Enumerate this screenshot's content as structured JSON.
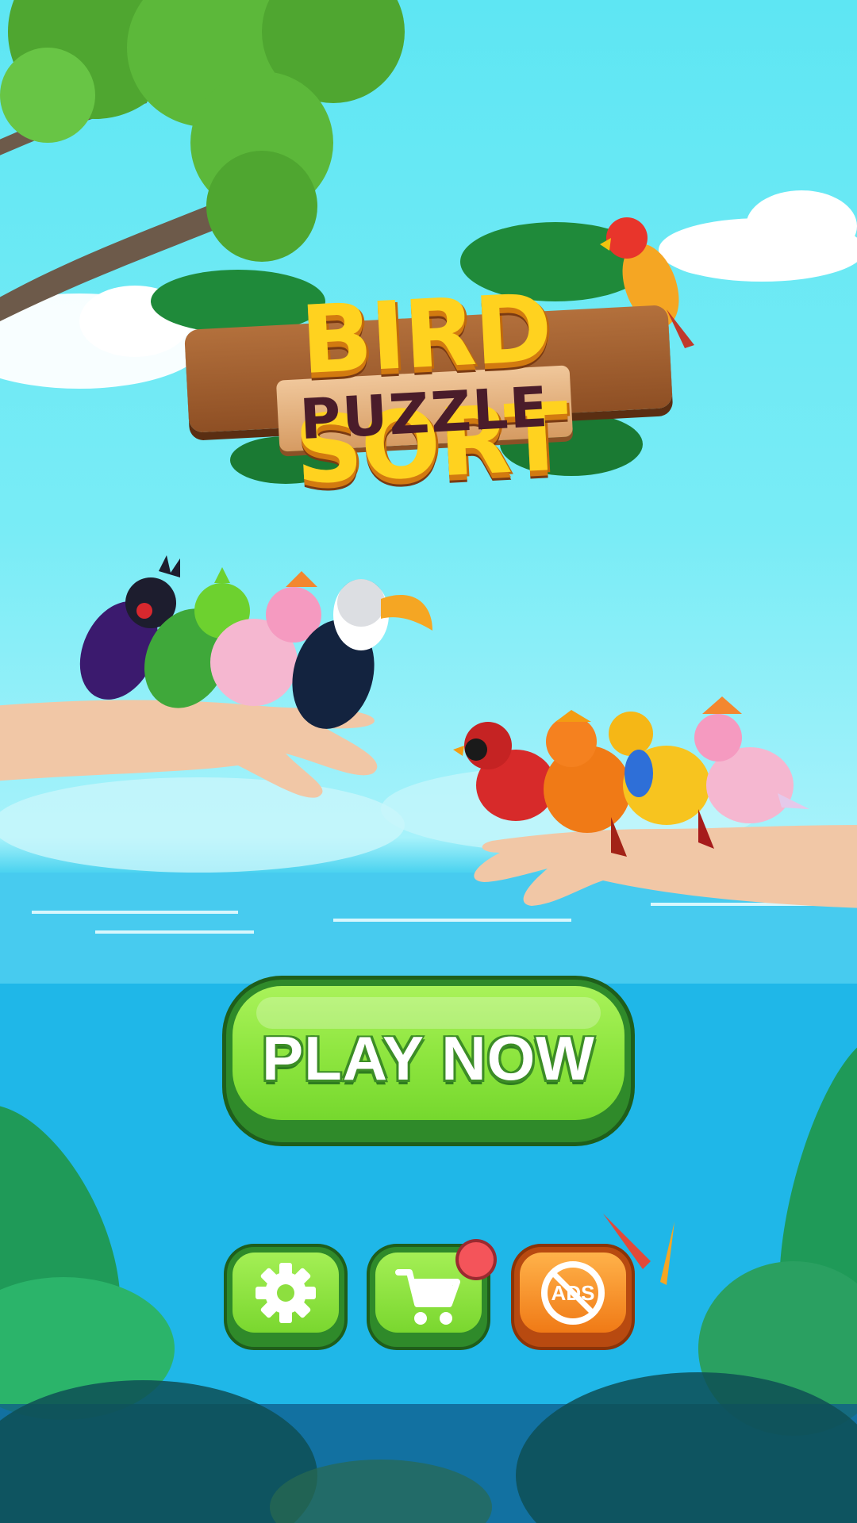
{
  "game": {
    "title": "BIRD SORT",
    "subtitle": "PUZZLE"
  },
  "buttons": {
    "play_label": "PLAY NOW",
    "settings_icon": "gear-icon",
    "shop_icon": "cart-icon",
    "no_ads_icon": "no-ads-icon",
    "no_ads_text": "ADS"
  },
  "colors": {
    "sky": "#5ee6f3",
    "sea": "#17b3e6",
    "play_green": "#8fe640",
    "no_ads_orange": "#f07a16",
    "notification_red": "#f4545a"
  },
  "birds_left_hand": [
    "black palm cockatoo",
    "green turaco",
    "pink galah cockatoo",
    "toucan"
  ],
  "birds_right_hand": [
    "cardinal",
    "orange cock-of-the-rock",
    "golden pheasant",
    "pink galah cockatoo"
  ]
}
